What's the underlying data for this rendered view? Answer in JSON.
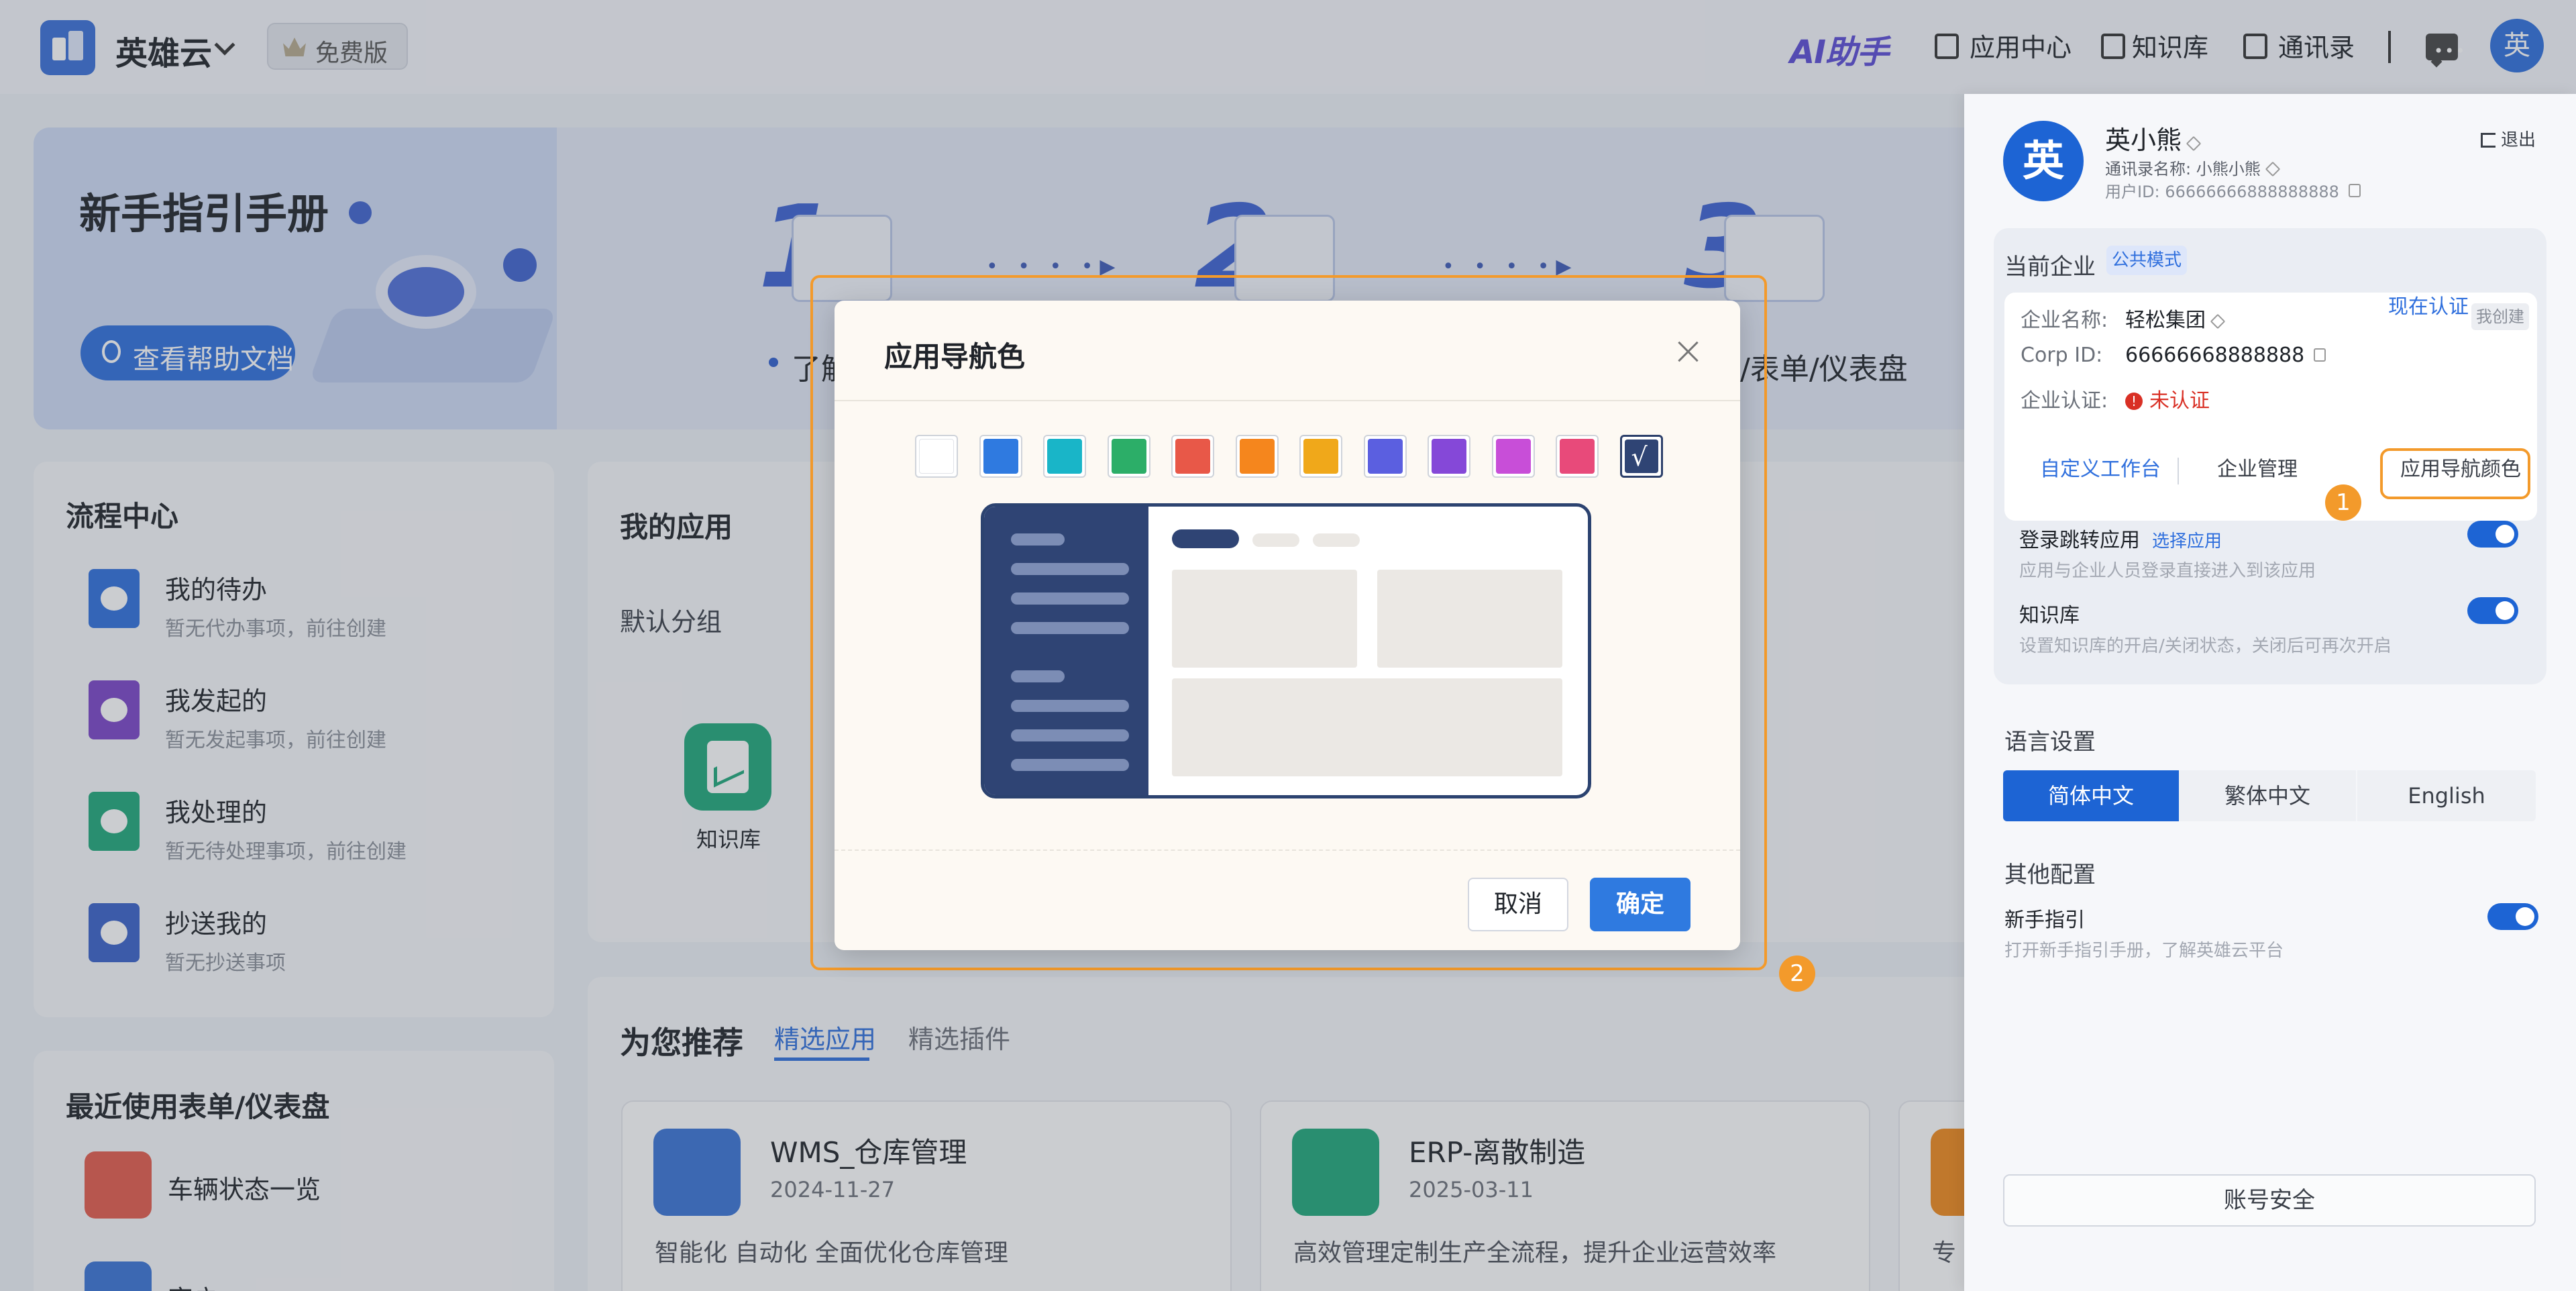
{
  "topbar": {
    "brand": "英雄云",
    "edition": "免费版",
    "ai_assistant": "AI助手",
    "nav": [
      "应用中心",
      "知识库",
      "通讯录"
    ],
    "avatar_char": "英"
  },
  "banner": {
    "title": "新手指引手册",
    "help_button": "查看帮助文档",
    "steps": [
      {
        "num": "1",
        "label": "了解"
      },
      {
        "num": "2",
        "label": ""
      },
      {
        "num": "3",
        "label": "程/表单/仪表盘"
      }
    ]
  },
  "flow_center": {
    "title": "流程中心",
    "items": [
      {
        "title": "我的待办",
        "sub": "暂无代办事项，前往创建",
        "color": "#2f6fdd"
      },
      {
        "title": "我发起的",
        "sub": "暂无发起事项，前往创建",
        "color": "#7a45c8"
      },
      {
        "title": "我处理的",
        "sub": "暂无待处理事项，前往创建",
        "color": "#1fa87a"
      },
      {
        "title": "抄送我的",
        "sub": "暂无抄送事项",
        "color": "#3a62c9"
      }
    ]
  },
  "recent": {
    "title": "最近使用表单/仪表盘",
    "items": [
      "车辆状态一览",
      "客户"
    ]
  },
  "my_apps": {
    "title": "我的应用",
    "group": "默认分组",
    "apps": [
      {
        "name": "知识库"
      }
    ]
  },
  "recommend": {
    "title": "为您推荐",
    "tabs": [
      "精选应用",
      "精选插件"
    ],
    "apps": [
      {
        "name": "WMS_仓库管理",
        "date": "2024-11-27",
        "desc": "智能化 自动化 全面优化仓库管理",
        "color": "#3a74d6"
      },
      {
        "name": "ERP-离散制造",
        "date": "2025-03-11",
        "desc": "高效管理定制生产全流程，提升企业运营效率",
        "color": "#1fa87a"
      },
      {
        "name": "",
        "date": "",
        "desc": "专",
        "color": "#f08a1c"
      }
    ]
  },
  "panel": {
    "avatar_char": "英",
    "user_name": "英小熊",
    "contact_name_label": "通讯录名称:",
    "contact_name": "小熊小熊",
    "user_id_label": "用户ID:",
    "user_id": "66666666888888888",
    "logout": "退出",
    "current_company_label": "当前企业",
    "mode_badge": "公共模式",
    "company_name_label": "企业名称:",
    "company_name": "轻松集团",
    "own_badge": "我创建",
    "corp_id_label": "Corp ID:",
    "corp_id": "66666668888888",
    "cert_label": "企业认证:",
    "cert_status": "未认证",
    "cert_link": "现在认证",
    "tabs": [
      "自定义工作台",
      "企业管理",
      "应用导航颜色"
    ],
    "login_redirect": {
      "title": "登录跳转应用",
      "link": "选择应用",
      "sub": "应用与企业人员登录直接进入到该应用"
    },
    "knowledge": {
      "title": "知识库",
      "sub": "设置知识库的开启/关闭状态，关闭后可再次开启"
    },
    "lang_label": "语言设置",
    "langs": [
      "简体中文",
      "繁体中文",
      "English"
    ],
    "other_label": "其他配置",
    "guide": {
      "title": "新手指引",
      "sub": "打开新手指引手册，了解英雄云平台"
    },
    "security_button": "账号安全"
  },
  "annotations": [
    "1",
    "2"
  ],
  "modal": {
    "title": "应用导航色",
    "swatches": [
      {
        "name": "white",
        "color": "#ffffff"
      },
      {
        "name": "blue",
        "color": "#2f7ae0"
      },
      {
        "name": "cyan",
        "color": "#19b5c8"
      },
      {
        "name": "green",
        "color": "#2cae68"
      },
      {
        "name": "red",
        "color": "#e85848"
      },
      {
        "name": "orange",
        "color": "#f5861d"
      },
      {
        "name": "yellow",
        "color": "#f0a81a"
      },
      {
        "name": "indigo",
        "color": "#5b5fe0"
      },
      {
        "name": "purple",
        "color": "#8548d8"
      },
      {
        "name": "magenta",
        "color": "#c84ed8"
      },
      {
        "name": "pink",
        "color": "#e84a7a"
      },
      {
        "name": "navy",
        "color": "#2f4474"
      }
    ],
    "selected": "navy",
    "check_glyph": "√",
    "cancel": "取消",
    "confirm": "确定"
  }
}
